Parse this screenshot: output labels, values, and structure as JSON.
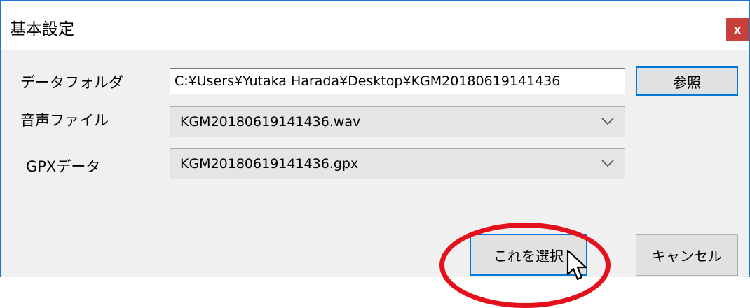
{
  "window": {
    "title": "基本設定",
    "close_label": "x"
  },
  "form": {
    "data_folder": {
      "label": "データフォルダ",
      "value": "C:¥Users¥Yutaka Harada¥Desktop¥KGM20180619141436",
      "browse_label": "参照"
    },
    "audio_file": {
      "label": "音声ファイル",
      "selected": "KGM20180619141436.wav"
    },
    "gpx_data": {
      "label": "GPXデータ",
      "selected": "KGM20180619141436.gpx"
    }
  },
  "actions": {
    "select_label": "これを選択",
    "cancel_label": "キャンセル"
  },
  "colors": {
    "accent": "#0078d7",
    "close": "#c9403a",
    "highlight": "#e4101c"
  },
  "icons": [
    "close-icon",
    "chevron-down-icon",
    "mouse-pointer-icon"
  ]
}
